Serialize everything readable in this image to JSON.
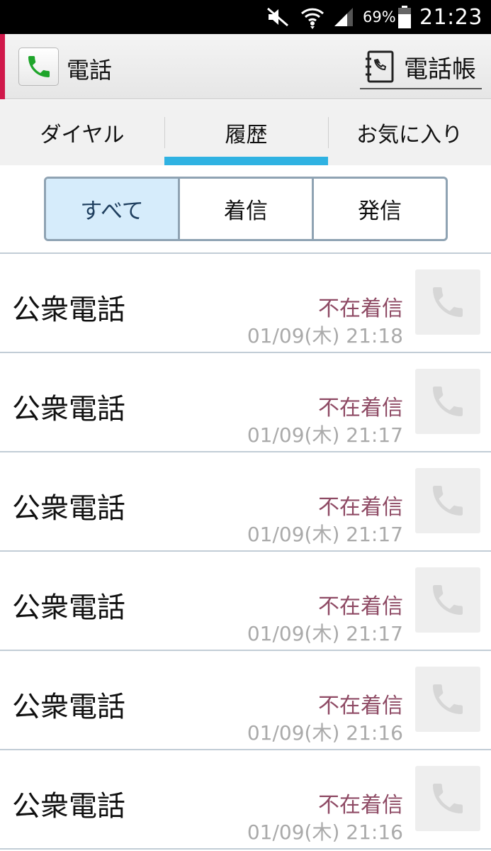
{
  "status_bar": {
    "battery_percent": "69%",
    "time": "21:23"
  },
  "app_bar": {
    "title": "電話",
    "phonebook_label": "電話帳",
    "accent_color": "#d0184a",
    "icons": {
      "app": "phone-handset-icon",
      "phonebook": "phonebook-icon"
    }
  },
  "tabs": [
    {
      "label": "ダイヤル",
      "selected": false
    },
    {
      "label": "履歴",
      "selected": true
    },
    {
      "label": "お気に入り",
      "selected": false
    }
  ],
  "filter": [
    {
      "label": "すべて",
      "selected": true
    },
    {
      "label": "着信",
      "selected": false
    },
    {
      "label": "発信",
      "selected": false
    }
  ],
  "calls": [
    {
      "name": "公衆電話",
      "type": "不在着信",
      "datetime": "01/09(木) 21:18"
    },
    {
      "name": "公衆電話",
      "type": "不在着信",
      "datetime": "01/09(木) 21:17"
    },
    {
      "name": "公衆電話",
      "type": "不在着信",
      "datetime": "01/09(木) 21:17"
    },
    {
      "name": "公衆電話",
      "type": "不在着信",
      "datetime": "01/09(木) 21:17"
    },
    {
      "name": "公衆電話",
      "type": "不在着信",
      "datetime": "01/09(木) 21:16"
    },
    {
      "name": "公衆電話",
      "type": "不在着信",
      "datetime": "01/09(木) 21:16"
    }
  ],
  "colors": {
    "tab_indicator": "#2fb2e2",
    "missed_call_text": "#8e4a64",
    "filter_active_bg": "#d6ecfb"
  }
}
